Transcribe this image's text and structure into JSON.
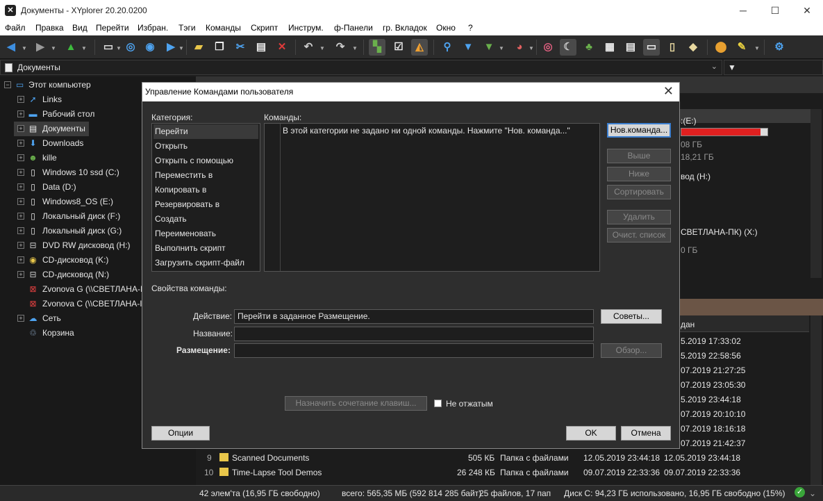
{
  "window": {
    "title": "Документы - XYplorer 20.20.0200",
    "min": "─",
    "max": "☐",
    "close": "✕"
  },
  "menu": [
    "Файл",
    "Правка",
    "Вид",
    "Перейти",
    "Избран.",
    "Тэги",
    "Команды",
    "Скрипт",
    "Инструм.",
    "ф-Панели",
    "гр. Вкладок",
    "Окно",
    "?"
  ],
  "address": {
    "text": "Документы"
  },
  "tree": {
    "items": [
      {
        "label": "Этот компьютер",
        "icon": "computer-icon"
      },
      {
        "label": "Links",
        "icon": "links-icon"
      },
      {
        "label": "Рабочий стол",
        "icon": "desktop-icon"
      },
      {
        "label": "Документы",
        "icon": "documents-icon"
      },
      {
        "label": "Downloads",
        "icon": "downloads-icon"
      },
      {
        "label": "kille",
        "icon": "user-icon"
      },
      {
        "label": "Windows 10 ssd (C:)",
        "icon": "drive-icon"
      },
      {
        "label": "Data (D:)",
        "icon": "drive-icon"
      },
      {
        "label": "Windows8_OS (E:)",
        "icon": "drive-icon"
      },
      {
        "label": "Локальный диск (F:)",
        "icon": "drive-icon"
      },
      {
        "label": "Локальный диск (G:)",
        "icon": "drive-icon"
      },
      {
        "label": "DVD RW дисковод (H:)",
        "icon": "dvd-drive-icon"
      },
      {
        "label": "CD-дисковод (K:)",
        "icon": "cd-drive-icon"
      },
      {
        "label": "CD-дисковод (N:)",
        "icon": "cd-drive-icon"
      },
      {
        "label": "Zvonova G (\\\\СВЕТЛАНА-I",
        "icon": "network-drive-icon"
      },
      {
        "label": "Zvonova C (\\\\СВЕТЛАНА-I",
        "icon": "network-drive-icon"
      },
      {
        "label": "Сеть",
        "icon": "network-icon"
      },
      {
        "label": "Корзина",
        "icon": "recycle-bin-icon"
      }
    ]
  },
  "right_partial": {
    "drive_e": ":(E:)",
    "drive_e_free": "08 ГБ",
    "drive_e_total": "18,21 ГБ",
    "drive_h": "вод (H:)",
    "drive_x": "СВЕТЛАНА-ПК) (X:)",
    "drive_x_size": "0 ГБ",
    "col_header": "дан",
    "dates": [
      "5.2019 17:33:02",
      "5.2019 22:58:56",
      "07.2019 21:27:25",
      "07.2019 23:05:30",
      "5.2019 23:44:18",
      "07.2019 20:10:10",
      "07.2019 18:16:18",
      "07.2019 21:42:37"
    ]
  },
  "rows": [
    {
      "num": "9",
      "name": "Scanned Documents",
      "size": "505 КБ",
      "type": "Папка с файлами",
      "modified": "12.05.2019 23:44:18",
      "created": "12.05.2019 23:44:18"
    },
    {
      "num": "10",
      "name": "Time-Lapse Tool Demos",
      "size": "26 248 КБ",
      "type": "Папка с файлами",
      "modified": "09.07.2019 22:33:36",
      "created": "09.07.2019 22:33:36"
    }
  ],
  "status": {
    "items": "42 элем'та (16,95 ГБ свободно)",
    "total": "всего: 565,35 МБ (592 814 285 байт)",
    "files": "25 файлов, 17 пап",
    "disk": "Диск C:  94,23 ГБ использовано,  16,95 ГБ свободно (15%)"
  },
  "dialog": {
    "title": "Управление Командами пользователя",
    "category_label": "Категория:",
    "commands_label": "Команды:",
    "categories": [
      "Перейти",
      "Открыть",
      "Открыть с помощью",
      "Переместить в",
      "Копировать в",
      "Резервировать в",
      "Создать",
      "Переименовать",
      "Выполнить скрипт",
      "Загрузить скрипт-файл"
    ],
    "selected_category": "Перейти",
    "commands_empty": "В этой категории не задано ни одной команды. Нажмите \"Нов. команда...\"",
    "buttons": {
      "new": "Нов.команда...",
      "up": "Выше",
      "down": "Ниже",
      "sort": "Сортировать",
      "delete": "Удалить",
      "clear": "Очист. список",
      "tips": "Советы...",
      "browse": "Обзор...",
      "hotkey": "Назначить сочетание клавиш...",
      "options": "Опции",
      "ok": "OK",
      "cancel": "Отмена"
    },
    "props_label": "Свойства команды:",
    "action_label": "Действие:",
    "action_value": "Перейти в заданное Размещение.",
    "name_label": "Название:",
    "name_value": "",
    "location_label": "Размещение:",
    "location_value": "",
    "unchecked_label": "Не отжатым"
  }
}
